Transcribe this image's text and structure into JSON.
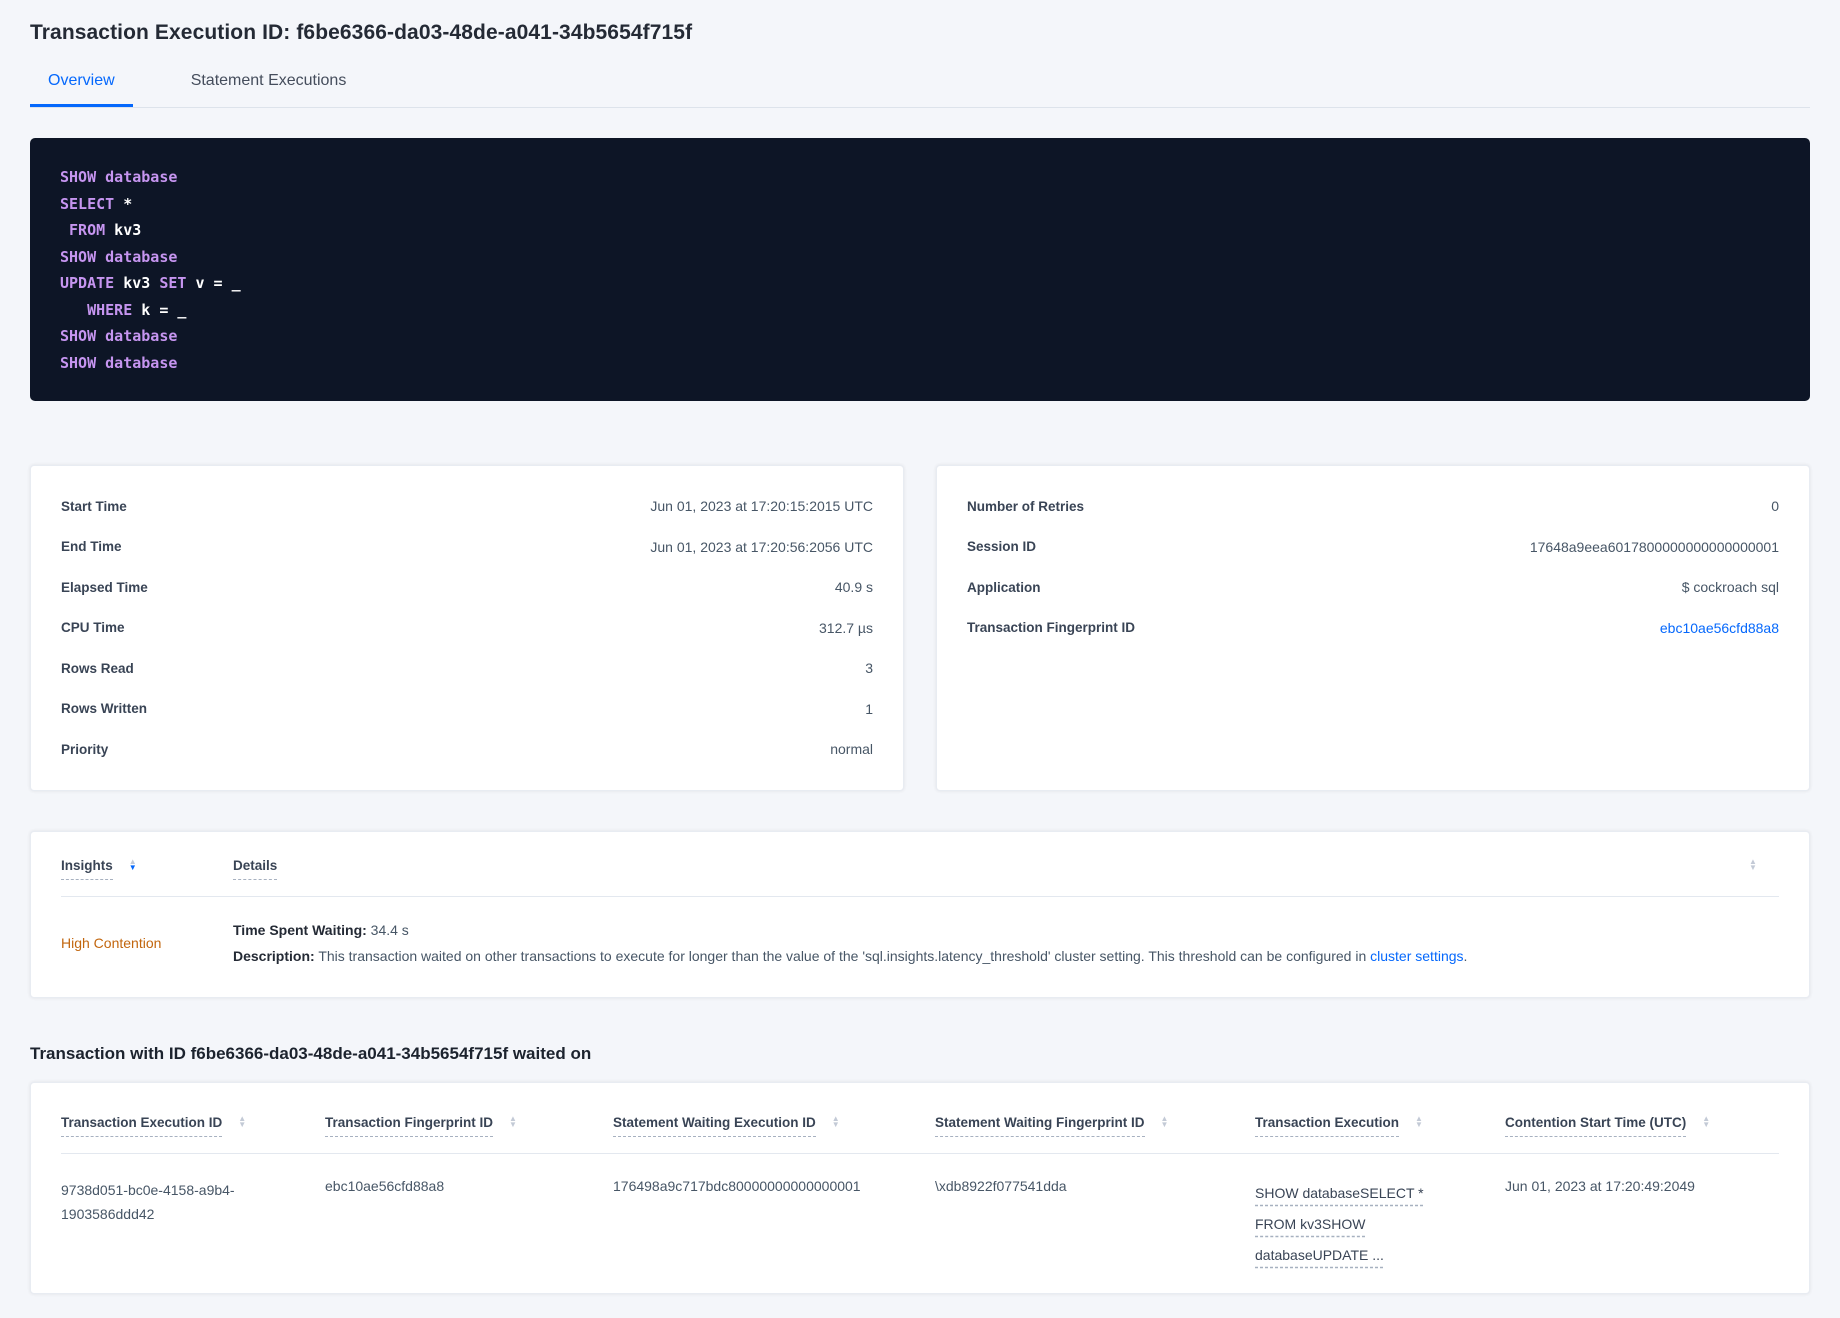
{
  "page": {
    "title": "Transaction Execution ID: f6be6366-da03-48de-a041-34b5654f715f"
  },
  "tabs": [
    {
      "label": "Overview"
    },
    {
      "label": "Statement Executions"
    }
  ],
  "icons": {
    "sort_asc": "▲",
    "sort_desc": "▼"
  },
  "colors": {
    "accent_blue": "#0568fc",
    "insight_orange": "#c2660e",
    "code_keyword_purple": "#c695f0",
    "code_background": "#0d1526"
  },
  "sql_box": {
    "lines": [
      [
        [
          "k",
          "SHOW"
        ],
        [
          "p",
          " "
        ],
        [
          "k",
          "database"
        ]
      ],
      [
        [
          "k",
          "SELECT"
        ],
        [
          "p",
          " *"
        ]
      ],
      [
        [
          "p",
          " "
        ],
        [
          "k",
          "FROM"
        ],
        [
          "p",
          " kv3"
        ]
      ],
      [
        [
          "k",
          "SHOW"
        ],
        [
          "p",
          " "
        ],
        [
          "k",
          "database"
        ]
      ],
      [
        [
          "k",
          "UPDATE"
        ],
        [
          "p",
          " kv3 "
        ],
        [
          "k",
          "SET"
        ],
        [
          "p",
          " v = _"
        ]
      ],
      [
        [
          "p",
          "   "
        ],
        [
          "k",
          "WHERE"
        ],
        [
          "p",
          " k = _"
        ]
      ],
      [
        [
          "k",
          "SHOW"
        ],
        [
          "p",
          " "
        ],
        [
          "k",
          "database"
        ]
      ],
      [
        [
          "k",
          "SHOW"
        ],
        [
          "p",
          " "
        ],
        [
          "k",
          "database"
        ]
      ]
    ]
  },
  "summary_left": {
    "rows": [
      {
        "label": "Start Time",
        "value": "Jun 01, 2023 at 17:20:15:2015 UTC"
      },
      {
        "label": "End Time",
        "value": "Jun 01, 2023 at 17:20:56:2056 UTC"
      },
      {
        "label": "Elapsed Time",
        "value": "40.9 s"
      },
      {
        "label": "CPU Time",
        "value": "312.7 µs"
      },
      {
        "label": "Rows Read",
        "value": "3"
      },
      {
        "label": "Rows Written",
        "value": "1"
      },
      {
        "label": "Priority",
        "value": "normal"
      }
    ]
  },
  "summary_right": {
    "rows": [
      {
        "label": "Number of Retries",
        "value": "0"
      },
      {
        "label": "Session ID",
        "value": "17648a9eea6017800000000000000001"
      },
      {
        "label": "Application",
        "value": "$ cockroach sql"
      },
      {
        "label": "Transaction Fingerprint ID",
        "value": "ebc10ae56cfd88a8",
        "link": true
      }
    ]
  },
  "insights_table": {
    "col_insights": "Insights",
    "col_details": "Details",
    "row": {
      "insight": "High Contention",
      "waiting_label": "Time Spent Waiting:",
      "waiting_value": " 34.4 s",
      "description_label": "Description:",
      "description_text": " This transaction waited on other transactions to execute for longer than the value of the 'sql.insights.latency_threshold' cluster setting. This threshold can be configured in ",
      "description_link": "cluster settings",
      "description_suffix": "."
    }
  },
  "waited_on": {
    "heading": "Transaction with ID f6be6366-da03-48de-a041-34b5654f715f waited on",
    "columns": [
      "Transaction Execution ID",
      "Transaction Fingerprint ID",
      "Statement Waiting Execution ID",
      "Statement Waiting Fingerprint ID",
      "Transaction Execution",
      "Contention Start Time (UTC)"
    ],
    "rows": [
      {
        "transaction_execution_id": "9738d051-bc0e-4158-a9b4-1903586ddd42",
        "transaction_fingerprint_id": "ebc10ae56cfd88a8",
        "statement_waiting_execution_id": "176498a9c717bdc80000000000000001",
        "statement_waiting_fingerprint_id": "\\xdb8922f077541dda",
        "transaction_execution": "SHOW databaseSELECT * FROM kv3SHOW databaseUPDATE ...",
        "contention_start_time": "Jun 01, 2023 at 17:20:49:2049"
      }
    ]
  }
}
